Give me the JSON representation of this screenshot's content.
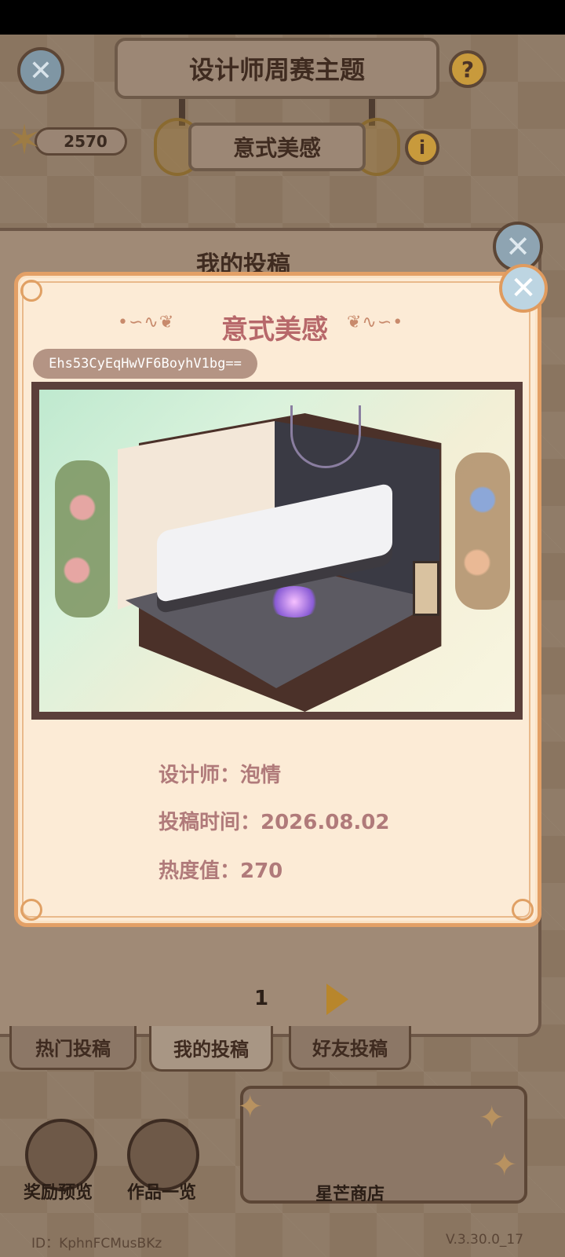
{
  "header": {
    "title": "设计师周赛主题",
    "theme": "意式美感",
    "star_count": "2570"
  },
  "panel": {
    "title": "我的投稿",
    "page_number": "1"
  },
  "tabs": [
    {
      "label": "热门投稿",
      "active": false
    },
    {
      "label": "我的投稿",
      "active": true
    },
    {
      "label": "好友投稿",
      "active": false
    }
  ],
  "bottom": {
    "reward_label": "奖励预览",
    "works_label": "作品一览",
    "shop_label": "星芒商店",
    "user_id": "ID：KphnFCMusBKz",
    "version": "V.3.30.0_17"
  },
  "modal": {
    "title": "意式美感",
    "code": "Ehs53CyEqHwVF6BoyhV1bg==",
    "designer": "设计师：泡情",
    "submit_time": "投稿时间：2026.08.02",
    "heat": "热度值：270"
  },
  "colors": {
    "modal_bg": "#fcebd6",
    "modal_border": "#e3a066",
    "title_color": "#b7686a",
    "info_text": "#b07a7a"
  },
  "icons": [
    "close-icon",
    "help-icon",
    "info-icon",
    "star-icon",
    "next-arrow-icon",
    "reward-cup-icon",
    "book-icon"
  ]
}
